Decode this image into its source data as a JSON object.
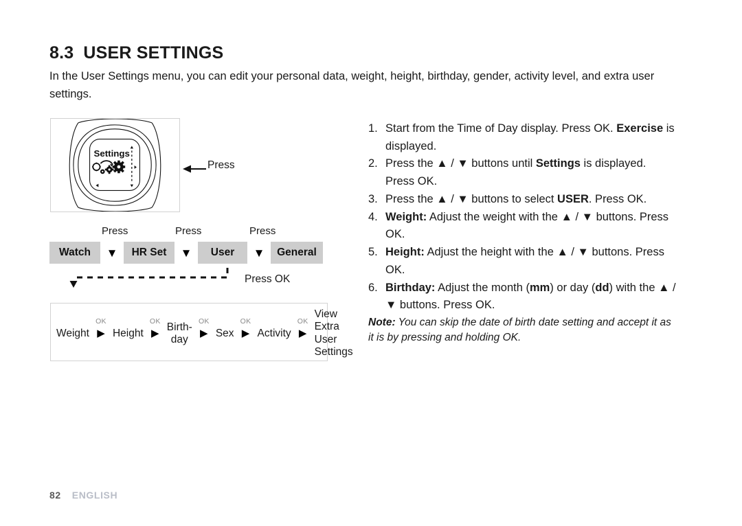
{
  "header": {
    "section_number": "8.3",
    "title": "USER SETTINGS",
    "intro": "In the User Settings menu, you can edit your personal data, weight, height, birthday, gender, activity level, and extra user settings."
  },
  "watch_figure": {
    "display_label": "Settings",
    "callout_label": "Press",
    "icon_name": "gears-settings-icon"
  },
  "menu_flow": {
    "press_labels": [
      "Press",
      "Press",
      "Press"
    ],
    "chips": [
      "Watch",
      "HR Set",
      "User",
      "General"
    ],
    "down_arrow": "▼",
    "press_ok_label": "Press OK"
  },
  "sequence": {
    "ok_tag": "OK",
    "arrow": "▶",
    "items": [
      "Weight",
      "Height",
      "Birth-\nday",
      "Sex",
      "Activity"
    ],
    "items_display": [
      "Weight",
      "Height",
      "Birth-",
      "Sex",
      "Activity"
    ],
    "birthday_line2": "day",
    "final": "View Extra User Settings",
    "final_lines": [
      "View",
      "Extra",
      "User",
      "Settings"
    ]
  },
  "steps": [
    {
      "index": "1.",
      "parts": [
        {
          "t": "Start from the Time of Day display. Press OK. ",
          "b": false
        },
        {
          "t": "Exercise",
          "b": true
        },
        {
          "t": " is displayed.",
          "b": false
        }
      ]
    },
    {
      "index": "2.",
      "parts": [
        {
          "t": "Press the ",
          "b": false
        },
        {
          "t": "▲ / ▼",
          "b": false
        },
        {
          "t": " buttons until ",
          "b": false
        },
        {
          "t": "Settings",
          "b": true
        },
        {
          "t": " is displayed. Press OK.",
          "b": false
        }
      ]
    },
    {
      "index": "3.",
      "parts": [
        {
          "t": "Press the ",
          "b": false
        },
        {
          "t": "▲ / ▼",
          "b": false
        },
        {
          "t": " buttons to select ",
          "b": false
        },
        {
          "t": "USER",
          "b": true
        },
        {
          "t": ". Press OK.",
          "b": false
        }
      ]
    },
    {
      "index": "4.",
      "parts": [
        {
          "t": "Weight:",
          "b": true
        },
        {
          "t": " Adjust the weight with the ",
          "b": false
        },
        {
          "t": "▲ / ▼",
          "b": false
        },
        {
          "t": " buttons. Press OK.",
          "b": false
        }
      ]
    },
    {
      "index": "5.",
      "parts": [
        {
          "t": "Height:",
          "b": true
        },
        {
          "t": " Adjust the height with the ",
          "b": false
        },
        {
          "t": "▲ / ▼",
          "b": false
        },
        {
          "t": " buttons. Press OK.",
          "b": false
        }
      ]
    },
    {
      "index": "6.",
      "parts": [
        {
          "t": "Birthday:",
          "b": true
        },
        {
          "t": " Adjust the month (",
          "b": false
        },
        {
          "t": "mm",
          "b": true
        },
        {
          "t": ") or day (",
          "b": false
        },
        {
          "t": "dd",
          "b": true
        },
        {
          "t": ") with the ",
          "b": false
        },
        {
          "t": "▲ / ▼",
          "b": false
        },
        {
          "t": " buttons. Press OK.",
          "b": false
        }
      ]
    }
  ],
  "note": {
    "label": "Note:",
    "text": " You can skip the date of birth date setting and accept it as it is by pressing and holding OK."
  },
  "footer": {
    "page_number": "82",
    "language": "ENGLISH"
  },
  "colors": {
    "chip_gray": "#cdcdcd",
    "box_border": "#d2d2d2",
    "ok_tag_gray": "#8a8a8a",
    "footer_lang": "#b9bdc7",
    "text": "#1a1a1a"
  }
}
